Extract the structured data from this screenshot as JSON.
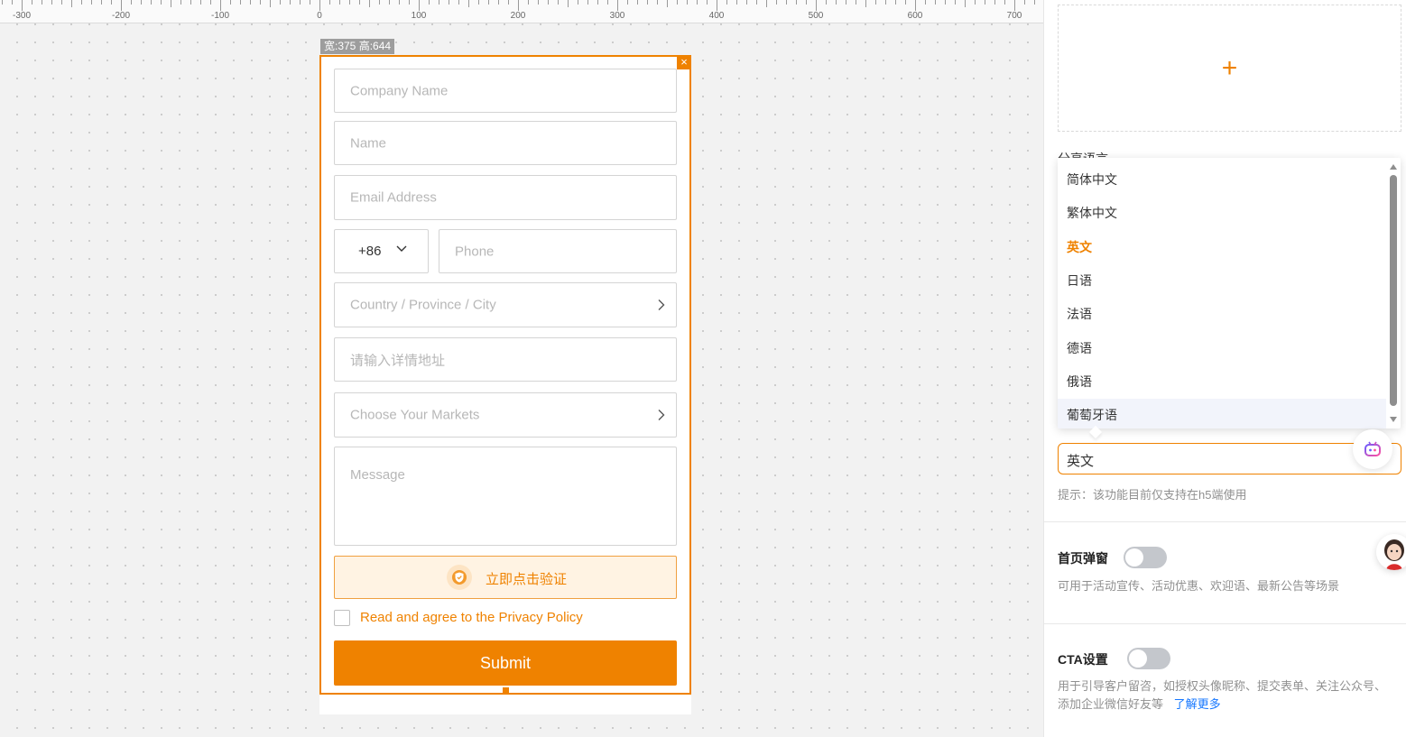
{
  "ruler": {
    "labels": [
      "-300",
      "-200",
      "-100",
      "0",
      "100",
      "200",
      "300",
      "400",
      "500",
      "600",
      "700"
    ]
  },
  "canvas": {
    "size_tag": "宽:375 高:644",
    "close_glyph": "×"
  },
  "form": {
    "company_placeholder": "Company Name",
    "name_placeholder": "Name",
    "email_placeholder": "Email Address",
    "country_code": "+86",
    "phone_placeholder": "Phone",
    "region_placeholder": "Country / Province / City",
    "address_placeholder": "请输入详情地址",
    "markets_placeholder": "Choose Your Markets",
    "message_placeholder": "Message",
    "verify_label": "立即点击验证",
    "agree_label": "Read and agree to the Privacy Policy",
    "submit_label": "Submit"
  },
  "panel": {
    "upload_plus": "+",
    "language_label": "分享语言",
    "language_options": [
      "简体中文",
      "繁体中文",
      "英文",
      "日语",
      "法语",
      "德语",
      "俄语",
      "葡萄牙语"
    ],
    "selected_language": "英文",
    "language_hint": "提示：该功能目前仅支持在h5端使用",
    "popup_title": "首页弹窗",
    "popup_hint": "可用于活动宣传、活动优惠、欢迎语、最新公告等场景",
    "cta_title": "CTA设置",
    "cta_hint_line1": "用于引导客户留咨，如授权头像昵称、提交表单、关注公众号、",
    "cta_hint_line2": "添加企业微信好友等",
    "learn_more": "了解更多"
  },
  "colors": {
    "accent": "#ef8200",
    "link": "#1677ff",
    "toggle_off": "#c4c7cc"
  }
}
